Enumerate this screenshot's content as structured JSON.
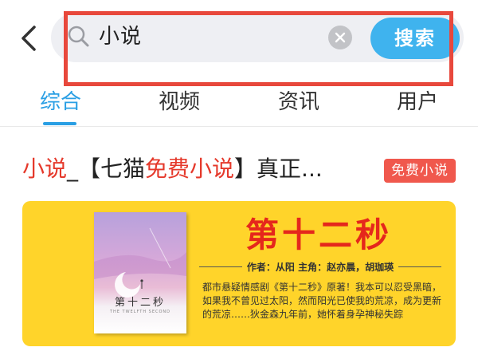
{
  "search": {
    "query": "小说",
    "button_label": "搜索"
  },
  "tabs": [
    {
      "label": "综合",
      "active": true
    },
    {
      "label": "视频",
      "active": false
    },
    {
      "label": "资讯",
      "active": false
    },
    {
      "label": "用户",
      "active": false
    }
  ],
  "result": {
    "title_parts": {
      "hl1": "小说",
      "mid1": "_【七猫",
      "hl2": "免费小说",
      "mid2": "】真正..."
    },
    "badge": "免费小说",
    "banner": {
      "book_title": "第十二秒",
      "cover_title": "第十二秒",
      "cover_subtitle": "THE TWELFTH SECOND",
      "credits": "作者：从阳   主角：赵亦晨，胡珈瑛",
      "description": "都市悬疑情感剧《第十二秒》原著！我本可以忍受黑暗，如果我不曾见过太阳，然而阳光已使我的荒凉，成为更新的荒凉……狄金森九年前，她怀着身孕神秘失踪"
    }
  },
  "colors": {
    "accent_blue": "#2a9fe4",
    "search_button": "#3fb3ee",
    "highlight_red": "#e8483c",
    "keyword_red": "#e5392b",
    "banner_yellow": "#ffd42a"
  },
  "icons": [
    "back-arrow-icon",
    "search-icon",
    "clear-icon"
  ]
}
